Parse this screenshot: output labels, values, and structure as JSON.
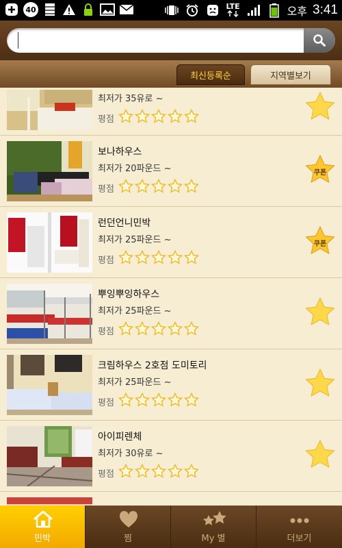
{
  "status_bar": {
    "notification_count": "40",
    "network": "LTE",
    "ampm": "오후",
    "time": "3:41"
  },
  "search": {
    "placeholder": "",
    "value": ""
  },
  "tabs": [
    {
      "label": "최신등록순",
      "active": true
    },
    {
      "label": "지역별보기",
      "active": false
    }
  ],
  "rating_label": "평점",
  "listings": [
    {
      "name": "",
      "price": "최저가 35유로 ~",
      "stars": 0,
      "coupon": false,
      "coupon_text": ""
    },
    {
      "name": "보나하우스",
      "price": "최저가 20파운드 ~",
      "stars": 0,
      "coupon": true,
      "coupon_text": "쿠폰"
    },
    {
      "name": "런던언니민박",
      "price": "최저가 25파운드 ~",
      "stars": 0,
      "coupon": true,
      "coupon_text": "쿠폰"
    },
    {
      "name": "뿌잉뿌잉하우스",
      "price": "최저가 25파운드 ~",
      "stars": 0,
      "coupon": false,
      "coupon_text": ""
    },
    {
      "name": "크림하우스 2호점 도미토리",
      "price": "최저가 25파운드 ~",
      "stars": 0,
      "coupon": false,
      "coupon_text": ""
    },
    {
      "name": "아이피렌체",
      "price": "최저가 30유로 ~",
      "stars": 0,
      "coupon": false,
      "coupon_text": ""
    }
  ],
  "bottom_nav": [
    {
      "label": "민박",
      "icon": "house-icon",
      "active": true
    },
    {
      "label": "찜",
      "icon": "heart-icon",
      "active": false
    },
    {
      "label": "My 별",
      "icon": "stars-icon",
      "active": false
    },
    {
      "label": "더보기",
      "icon": "more-icon",
      "active": false
    }
  ],
  "colors": {
    "accent_yellow": "#ffd000",
    "header_brown": "#5a3a1a",
    "list_background": "#f6edd3",
    "star_fill": "#ffd84a"
  }
}
